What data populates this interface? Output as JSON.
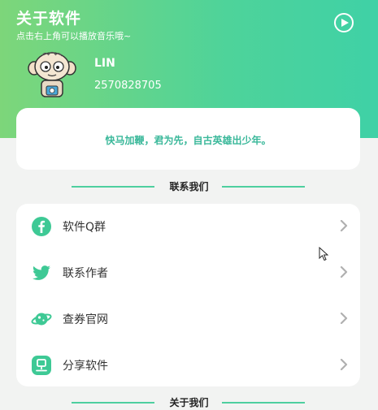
{
  "header": {
    "title": "关于软件",
    "subtitle": "点击右上角可以播放音乐哦~",
    "play_icon": "play-circle-icon"
  },
  "user": {
    "name": "LIN",
    "id": "2570828705"
  },
  "quote": "快马加鞭，君为先，自古英雄出少年。",
  "sections": {
    "contact_title": "联系我们",
    "about_title": "关于我们"
  },
  "menu": [
    {
      "label": "软件Q群",
      "icon": "facebook-icon"
    },
    {
      "label": "联系作者",
      "icon": "twitter-icon"
    },
    {
      "label": "查券官网",
      "icon": "planet-icon"
    },
    {
      "label": "分享软件",
      "icon": "share-icon"
    }
  ],
  "colors": {
    "accent": "#3fd1a6",
    "gradient_start": "#7dd67a",
    "icon_green": "#3ec995",
    "quote_text": "#3ab89a"
  }
}
